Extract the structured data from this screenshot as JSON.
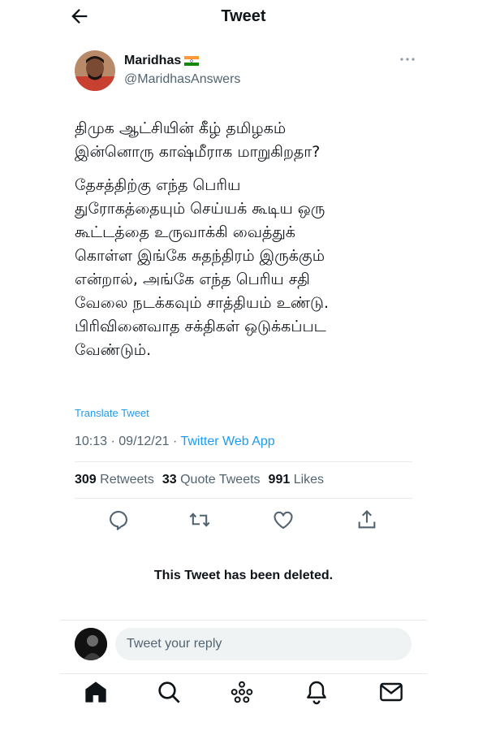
{
  "header": {
    "title": "Tweet",
    "back_icon": "back-arrow-icon"
  },
  "author": {
    "name": "Maridhas",
    "handle": "@MaridhasAnswers",
    "flag_icon": "india-flag-icon"
  },
  "tweet": {
    "paragraphs": [
      "திமுக ஆட்சியின் கீழ் தமிழகம்\nஇன்னொரு காஷ்மீராக மாறுகிறதா?",
      "தேசத்திற்கு எந்த பெரிய\nதுரோகத்தையும் செய்யக் கூடிய ஒரு\nகூட்டத்தை உருவாக்கி வைத்துக்\nகொள்ள இங்கே சுதந்திரம் இருக்கும்\nஎன்றால், அங்கே எந்த பெரிய சதி\nவேலை நடக்கவும் சாத்தியம் உண்டு.\nபிரிவினைவாத சக்திகள் ஒடுக்கப்பட\nவேண்டும்."
    ],
    "translate_label": "Translate Tweet",
    "time": "10:13",
    "date": "09/12/21",
    "separator": " · ",
    "source": "Twitter Web App"
  },
  "stats": {
    "retweets_count": "309",
    "retweets_label": "Retweets",
    "quotes_count": "33",
    "quotes_label": "Quote Tweets",
    "likes_count": "991",
    "likes_label": "Likes"
  },
  "actions": [
    "reply-icon",
    "retweet-icon",
    "like-icon",
    "share-icon"
  ],
  "deleted_notice": "This Tweet has been deleted.",
  "reply": {
    "placeholder": "Tweet your reply"
  },
  "bottom_nav": [
    "home-icon",
    "search-icon",
    "spaces-icon",
    "notifications-icon",
    "messages-icon"
  ],
  "colors": {
    "accent": "#1d9bf0",
    "secondary_text": "#536471",
    "primary_text": "#0f1419",
    "divider": "#e7e9ea"
  }
}
